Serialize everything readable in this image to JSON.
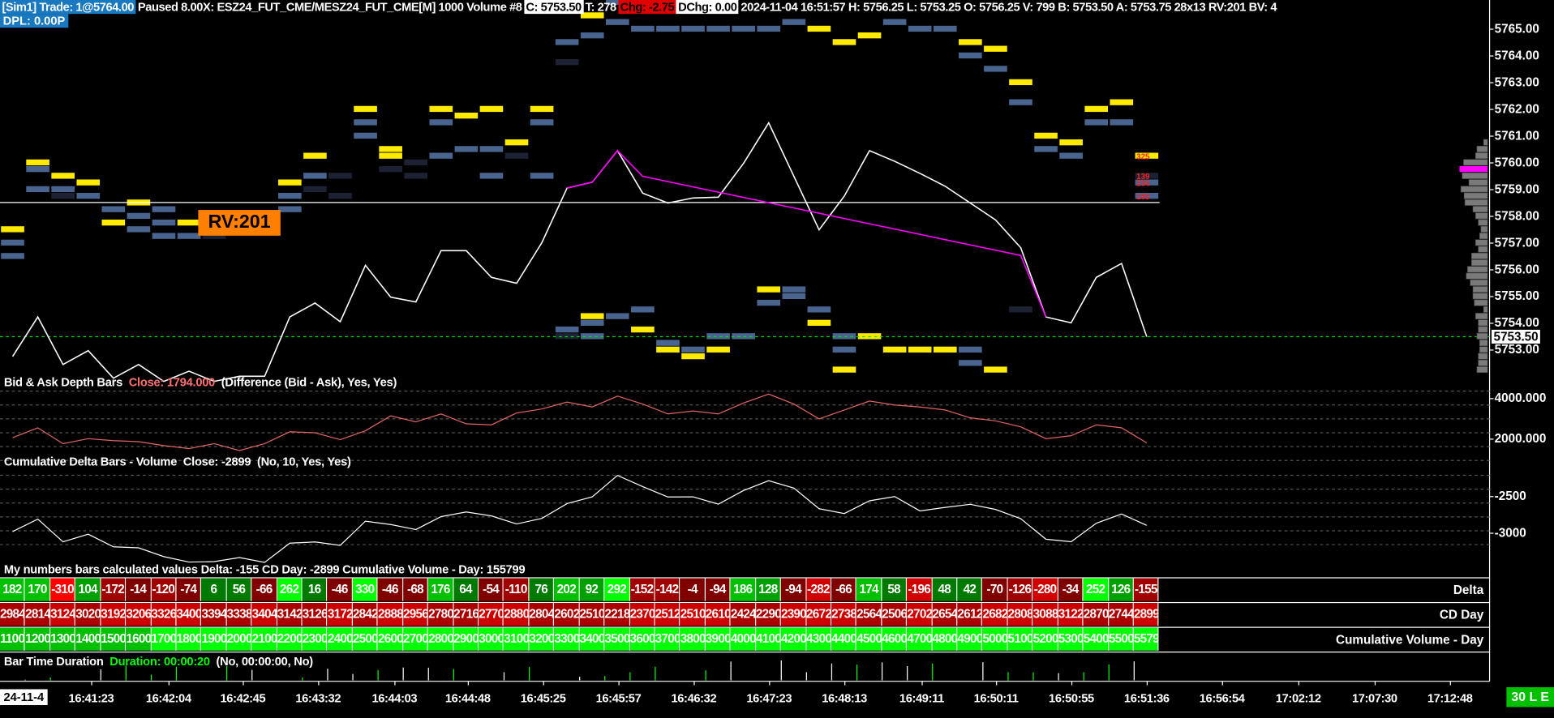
{
  "header": {
    "trade": "[Sim1]  Trade: 1@5764.00",
    "info": "Paused 8.00X: ESZ24_FUT_CME/MESZ24_FUT_CME[M]  1000 Volume #8",
    "close": "C: 5753.50",
    "ticks": "T: 278",
    "change": "Chg: -2.75",
    "dchange": "DChg: 0.00",
    "details": "2024-11-04 16:51:57 H: 5756.25 L: 5753.25 O: 5756.25 V: 799 B: 5753.50 A: 5753.75 28x13 RV:201 BV: 4",
    "dpl": "DPL: 0.00P"
  },
  "colors": {
    "ask": "#ffea00",
    "bid": "#4a6490",
    "dim": "#1c2233",
    "profile": "#7a7a7a",
    "poc": "#ff00ff",
    "depth_line": "#e06464",
    "green": "#00ff00"
  },
  "price_chart": {
    "axis_labels": [
      "5765.00",
      "5764.00",
      "5763.00",
      "5762.00",
      "5761.00",
      "5760.00",
      "5759.00",
      "5758.00",
      "5757.00",
      "5756.00",
      "5755.00",
      "5754.00",
      "5753.00"
    ],
    "last_price": "5753.50",
    "rv_label": "RV:201",
    "reference_line_price": 5758.5,
    "right_labels": [
      {
        "text": "325",
        "price": 5760.25
      },
      {
        "text": "139",
        "price": 5759.5
      },
      {
        "text": "234",
        "price": 5759.25
      },
      {
        "text": "183",
        "price": 5758.75
      }
    ],
    "white_line": [
      5752.74,
      5754.22,
      5752.44,
      5752.96,
      5751.93,
      5752.44,
      5751.81,
      5752.19,
      5751.81,
      5752.0,
      5752.0,
      5754.22,
      5754.74,
      5754.04,
      5756.15,
      5754.96,
      5754.78,
      5756.7,
      5756.7,
      5755.7,
      5755.48,
      5757.0,
      5759.04,
      5759.26,
      5760.44,
      5758.85,
      5758.48,
      5758.67,
      5758.7,
      5759.96,
      5761.48,
      5759.48,
      5757.48,
      5758.74,
      5760.44,
      5760.04,
      5759.59,
      5759.11,
      5758.48,
      5757.85,
      5756.81,
      5754.22,
      5754.0,
      5755.7,
      5756.22,
      5753.48
    ],
    "magenta_line": [
      [
        22,
        5759.04
      ],
      [
        23,
        5759.26
      ],
      [
        24,
        5760.44
      ],
      [
        25,
        5759.48
      ],
      [
        40,
        5756.52
      ],
      [
        41,
        5754.22
      ]
    ],
    "depth_blocks": [
      [
        0,
        5757.5,
        "ask"
      ],
      [
        0,
        5757.0,
        "bid"
      ],
      [
        0,
        5756.5,
        "bid"
      ],
      [
        1,
        5760.0,
        "ask"
      ],
      [
        1,
        5759.75,
        "bid"
      ],
      [
        1,
        5759.0,
        "bid"
      ],
      [
        2,
        5759.5,
        "ask"
      ],
      [
        2,
        5759.0,
        "bid"
      ],
      [
        2,
        5758.75,
        "dim"
      ],
      [
        3,
        5759.25,
        "ask"
      ],
      [
        3,
        5758.75,
        "bid"
      ],
      [
        4,
        5757.75,
        "ask"
      ],
      [
        4,
        5758.25,
        "bid"
      ],
      [
        5,
        5758.5,
        "ask"
      ],
      [
        5,
        5758.0,
        "bid"
      ],
      [
        5,
        5757.5,
        "bid"
      ],
      [
        6,
        5758.25,
        "bid"
      ],
      [
        6,
        5757.75,
        "bid"
      ],
      [
        6,
        5757.25,
        "bid"
      ],
      [
        7,
        5757.75,
        "ask"
      ],
      [
        7,
        5757.25,
        "bid"
      ],
      [
        8,
        5757.25,
        "dim"
      ],
      [
        9,
        5757.5,
        "dim"
      ],
      [
        10,
        5757.5,
        "dim"
      ],
      [
        11,
        5759.25,
        "ask"
      ],
      [
        11,
        5758.75,
        "bid"
      ],
      [
        11,
        5758.25,
        "bid"
      ],
      [
        12,
        5760.25,
        "ask"
      ],
      [
        12,
        5759.5,
        "bid"
      ],
      [
        12,
        5759.0,
        "dim"
      ],
      [
        13,
        5758.75,
        "dim"
      ],
      [
        13,
        5759.5,
        "dim"
      ],
      [
        14,
        5762.0,
        "ask"
      ],
      [
        14,
        5761.5,
        "bid"
      ],
      [
        14,
        5761.0,
        "bid"
      ],
      [
        15,
        5760.5,
        "ask"
      ],
      [
        15,
        5760.25,
        "ask"
      ],
      [
        15,
        5759.75,
        "dim"
      ],
      [
        16,
        5760.0,
        "dim"
      ],
      [
        16,
        5759.5,
        "dim"
      ],
      [
        17,
        5762.0,
        "ask"
      ],
      [
        17,
        5761.5,
        "bid"
      ],
      [
        17,
        5760.25,
        "bid"
      ],
      [
        18,
        5761.75,
        "ask"
      ],
      [
        18,
        5760.5,
        "bid"
      ],
      [
        19,
        5762.0,
        "ask"
      ],
      [
        19,
        5760.5,
        "bid"
      ],
      [
        19,
        5759.5,
        "bid"
      ],
      [
        20,
        5760.75,
        "ask"
      ],
      [
        20,
        5760.25,
        "dim"
      ],
      [
        21,
        5762.0,
        "ask"
      ],
      [
        21,
        5761.5,
        "bid"
      ],
      [
        21,
        5759.5,
        "bid"
      ],
      [
        22,
        5765.75,
        "ask"
      ],
      [
        22,
        5764.5,
        "bid"
      ],
      [
        22,
        5763.75,
        "dim"
      ],
      [
        22,
        5753.75,
        "bid"
      ],
      [
        22,
        5753.5,
        "dim"
      ],
      [
        23,
        5765.5,
        "ask"
      ],
      [
        23,
        5764.75,
        "bid"
      ],
      [
        23,
        5754.25,
        "ask"
      ],
      [
        23,
        5754.0,
        "bid"
      ],
      [
        23,
        5753.5,
        "bid"
      ],
      [
        24,
        5766.0,
        "bid"
      ],
      [
        24,
        5765.25,
        "bid"
      ],
      [
        24,
        5754.25,
        "bid"
      ],
      [
        25,
        5765.0,
        "bid"
      ],
      [
        25,
        5753.75,
        "ask"
      ],
      [
        25,
        5754.5,
        "bid"
      ],
      [
        26,
        5765.0,
        "bid"
      ],
      [
        26,
        5753.0,
        "ask"
      ],
      [
        26,
        5753.25,
        "bid"
      ],
      [
        27,
        5765.0,
        "bid"
      ],
      [
        27,
        5752.75,
        "ask"
      ],
      [
        27,
        5753.0,
        "bid"
      ],
      [
        28,
        5765.0,
        "bid"
      ],
      [
        28,
        5753.0,
        "ask"
      ],
      [
        28,
        5753.5,
        "bid"
      ],
      [
        29,
        5765.0,
        "bid"
      ],
      [
        29,
        5753.5,
        "bid"
      ],
      [
        30,
        5765.0,
        "bid"
      ],
      [
        30,
        5755.25,
        "ask"
      ],
      [
        30,
        5754.75,
        "bid"
      ],
      [
        31,
        5765.25,
        "bid"
      ],
      [
        31,
        5755.25,
        "bid"
      ],
      [
        31,
        5755.0,
        "bid"
      ],
      [
        32,
        5765.0,
        "ask"
      ],
      [
        32,
        5754.0,
        "ask"
      ],
      [
        32,
        5754.5,
        "bid"
      ],
      [
        33,
        5764.5,
        "ask"
      ],
      [
        33,
        5753.5,
        "bid"
      ],
      [
        33,
        5753.0,
        "bid"
      ],
      [
        33,
        5752.25,
        "ask"
      ],
      [
        34,
        5764.75,
        "ask"
      ],
      [
        34,
        5753.5,
        "ask"
      ],
      [
        35,
        5765.25,
        "bid"
      ],
      [
        35,
        5753.0,
        "ask"
      ],
      [
        36,
        5765.0,
        "bid"
      ],
      [
        36,
        5753.0,
        "ask"
      ],
      [
        37,
        5765.0,
        "bid"
      ],
      [
        37,
        5753.0,
        "ask"
      ],
      [
        38,
        5764.5,
        "ask"
      ],
      [
        38,
        5764.0,
        "bid"
      ],
      [
        38,
        5753.0,
        "bid"
      ],
      [
        38,
        5752.5,
        "bid"
      ],
      [
        39,
        5764.25,
        "ask"
      ],
      [
        39,
        5763.5,
        "bid"
      ],
      [
        39,
        5752.25,
        "ask"
      ],
      [
        40,
        5763.0,
        "ask"
      ],
      [
        40,
        5762.25,
        "bid"
      ],
      [
        40,
        5754.5,
        "dim"
      ],
      [
        41,
        5761.0,
        "ask"
      ],
      [
        41,
        5760.5,
        "bid"
      ],
      [
        42,
        5760.75,
        "ask"
      ],
      [
        42,
        5760.25,
        "bid"
      ],
      [
        43,
        5762.0,
        "ask"
      ],
      [
        43,
        5761.5,
        "bid"
      ],
      [
        44,
        5762.25,
        "ask"
      ],
      [
        44,
        5761.5,
        "bid"
      ],
      [
        45,
        5760.25,
        "ask"
      ],
      [
        45,
        5759.5,
        "dim"
      ],
      [
        45,
        5759.25,
        "bid"
      ],
      [
        45,
        5758.75,
        "bid"
      ]
    ],
    "volume_profile": {
      "prices_from": 5760.75,
      "tick": 0.25,
      "volumes": [
        15,
        40,
        45,
        90,
        105,
        95,
        70,
        100,
        88,
        85,
        55,
        45,
        35,
        25,
        30,
        45,
        35,
        60,
        60,
        75,
        80,
        65,
        55,
        55,
        50,
        15,
        45,
        35,
        35,
        40,
        30,
        30,
        35,
        35,
        40
      ],
      "poc_price": 5759.75
    }
  },
  "depth_study": {
    "name": "Bid & Ask Depth Bars",
    "close": "Close: 1794.000",
    "params": "(Difference (Bid - Ask), Yes, Yes)",
    "axis_labels": [
      {
        "text": "4000.000",
        "value": 4000
      },
      {
        "text": "2000.000",
        "value": 2000
      }
    ],
    "values": [
      2048,
      2536,
      1755,
      2000,
      1902,
      1853,
      1658,
      1512,
      1755,
      1414,
      1755,
      2341,
      2292,
      1951,
      2390,
      3122,
      2829,
      3219,
      2731,
      2683,
      3268,
      3463,
      3805,
      3561,
      4098,
      3707,
      3219,
      3366,
      3219,
      3756,
      4195,
      3707,
      2975,
      3414,
      3854,
      3659,
      3561,
      3414,
      3024,
      2878,
      2585,
      2000,
      2146,
      2683,
      2536,
      1794
    ]
  },
  "cd_study": {
    "name": "Cumulative Delta Bars - Volume",
    "close": "Close: -2899",
    "params": "(No, 10, Yes, Yes)",
    "axis_labels": [
      {
        "text": "-2500",
        "value": -2500
      },
      {
        "text": "-3000",
        "value": -3000
      }
    ]
  },
  "numbers_study": {
    "title": "My numbers bars calculated values  Delta: -155  CD Day: -2899  Cumulative Volume - Day: 155799",
    "row_labels": [
      "Delta",
      "CD Day",
      "Cumulative Volume - Day"
    ],
    "delta": [
      "182",
      "170",
      "-310",
      "104",
      "-172",
      "-14",
      "-120",
      "-74",
      "6",
      "56",
      "-66",
      "262",
      "16",
      "-46",
      "330",
      "-46",
      "-68",
      "176",
      "64",
      "-54",
      "-110",
      "76",
      "202",
      "92",
      "292",
      "-152",
      "-142",
      "-4",
      "-94",
      "186",
      "128",
      "-94",
      "-282",
      "-66",
      "174",
      "58",
      "-196",
      "48",
      "42",
      "-70",
      "-126",
      "-280",
      "-34",
      "252",
      "126",
      "-155"
    ],
    "cd_day": [
      "2984",
      "2814",
      "3124",
      "3020",
      "3192",
      "3206",
      "3326",
      "3400",
      "3394",
      "3338",
      "3404",
      "3142",
      "3126",
      "3172",
      "2842",
      "2888",
      "2956",
      "2780",
      "2716",
      "2770",
      "2880",
      "2804",
      "2602",
      "2510",
      "2218",
      "2370",
      "2512",
      "2510",
      "2610",
      "2424",
      "2290",
      "2390",
      "2672",
      "2738",
      "2564",
      "2506",
      "2702",
      "2654",
      "2612",
      "2682",
      "2808",
      "3088",
      "3122",
      "2870",
      "2744",
      "2899"
    ],
    "cum_volume": [
      "1100",
      "1200",
      "1300",
      "1400",
      "1500",
      "1600",
      "1700",
      "1800",
      "1900",
      "2000",
      "2100",
      "2200",
      "2300",
      "2400",
      "2500",
      "2600",
      "2700",
      "2800",
      "2900",
      "3000",
      "3100",
      "3200",
      "3300",
      "3400",
      "3500",
      "3600",
      "3700",
      "3800",
      "3900",
      "4000",
      "4100",
      "4200",
      "4300",
      "4400",
      "4500",
      "4600",
      "4700",
      "4800",
      "4900",
      "5000",
      "5100",
      "5200",
      "5300",
      "5400",
      "5500",
      "5579"
    ]
  },
  "duration_study": {
    "name": "Bar Time Duration",
    "duration": "Duration: 00:00:20",
    "params": "(No, 00:00:00, No)",
    "bars": [
      [
        1,
        3,
        "w"
      ],
      [
        2,
        13,
        "g"
      ],
      [
        4,
        50,
        "w"
      ],
      [
        5,
        68,
        "g"
      ],
      [
        6,
        26,
        "g"
      ],
      [
        7,
        62,
        "g"
      ],
      [
        9,
        65,
        "g"
      ],
      [
        10,
        48,
        "w"
      ],
      [
        12,
        13,
        "g"
      ],
      [
        13,
        53,
        "w"
      ],
      [
        14,
        29,
        "w"
      ],
      [
        15,
        47,
        "g"
      ],
      [
        16,
        59,
        "w"
      ],
      [
        17,
        58,
        "w"
      ],
      [
        18,
        52,
        "g"
      ],
      [
        20,
        37,
        "w"
      ],
      [
        21,
        61,
        "g"
      ],
      [
        23,
        16,
        "w"
      ],
      [
        24,
        20,
        "g"
      ],
      [
        25,
        37,
        "g"
      ],
      [
        26,
        62,
        "g"
      ],
      [
        28,
        46,
        "g"
      ],
      [
        29,
        86,
        "w"
      ],
      [
        31,
        91,
        "w"
      ],
      [
        32,
        37,
        "w"
      ],
      [
        33,
        77,
        "w"
      ],
      [
        34,
        72,
        "g"
      ],
      [
        35,
        82,
        "w"
      ],
      [
        36,
        65,
        "w"
      ],
      [
        37,
        77,
        "g"
      ],
      [
        39,
        83,
        "w"
      ],
      [
        40,
        37,
        "g"
      ],
      [
        41,
        37,
        "g"
      ],
      [
        42,
        33,
        "w"
      ],
      [
        43,
        37,
        "g"
      ],
      [
        44,
        73,
        "g"
      ],
      [
        45,
        87,
        "w"
      ]
    ]
  },
  "time_axis": {
    "date": "24-11-4",
    "labels": [
      "16:41:23",
      "16:42:04",
      "16:42:45",
      "16:43:32",
      "16:44:03",
      "16:44:48",
      "16:45:25",
      "16:45:57",
      "16:46:32",
      "16:47:23",
      "16:48:13",
      "16:49:11",
      "16:50:11",
      "16:50:55",
      "16:51:36",
      "16:56:54",
      "17:02:12",
      "17:07:30",
      "17:12:48"
    ],
    "mode": "30 L E"
  }
}
